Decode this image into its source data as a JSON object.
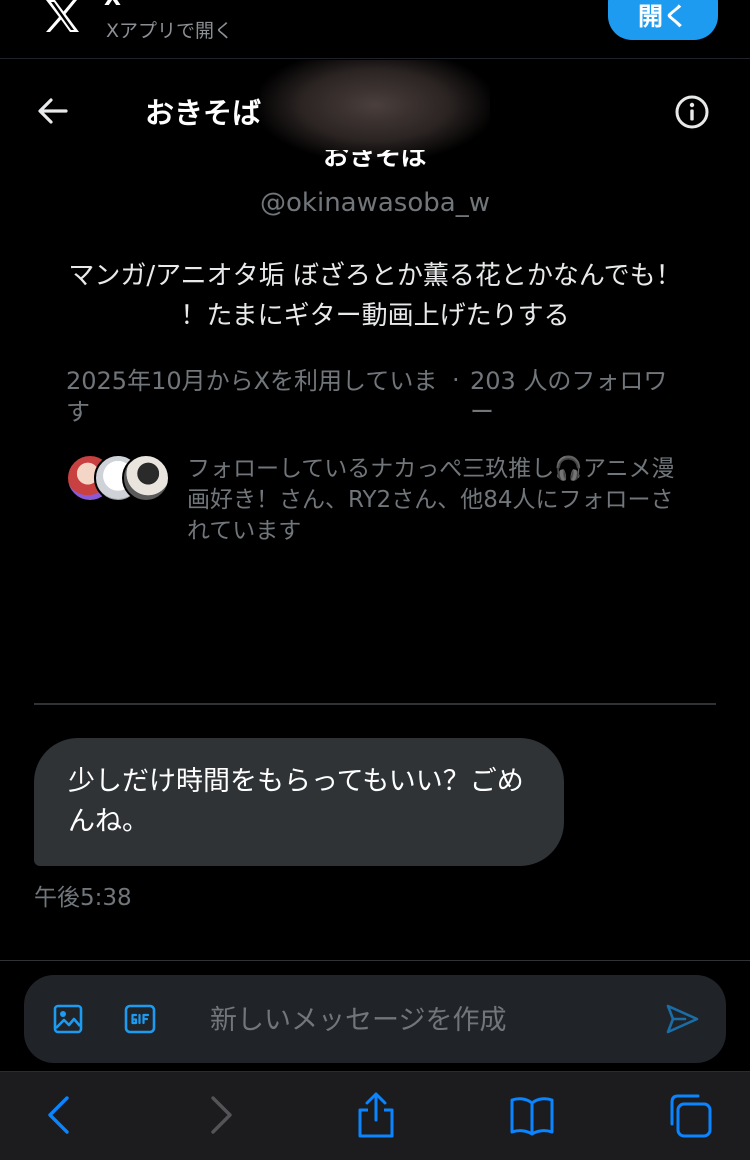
{
  "banner": {
    "logo": "x-logo-icon",
    "title": "X",
    "subtitle": "Xアプリで開く",
    "open_label": "開く"
  },
  "header": {
    "back_icon": "arrow-left-icon",
    "title": "おきそば",
    "info_icon": "info-circle-icon"
  },
  "profile": {
    "name": "おきそば",
    "handle": "@okinawasoba_w",
    "bio": "マンガ/アニオタ垢 ぼざろとか薫る花とかなんでも！ ！たまにギター動画上げたりする",
    "joined": "2025年10月からXを利用しています",
    "separator": "·",
    "followers": "203 人のフォロワー",
    "followed_by": "フォローしているナカっぺ三玖推し🎧アニメ漫画好き！さん、RY2さん、他84人にフォローされています"
  },
  "messages": [
    {
      "text": "少しだけ時間をもらってもいい？ごめんね。",
      "time": "午後5:38"
    }
  ],
  "composer": {
    "image_icon": "image-icon",
    "gif_icon": "gif-icon",
    "placeholder": "新しいメッセージを作成",
    "send_icon": "send-icon"
  },
  "toolbar": {
    "icons": [
      "chevron-left-icon",
      "chevron-right-icon",
      "share-icon",
      "bookmarks-icon",
      "tabs-icon"
    ]
  },
  "colors": {
    "background": "#000000",
    "accent": "#1d9bf0",
    "bubble": "#2f3336",
    "muted_text": "#71767b",
    "toolbar": "#1c1c1e"
  }
}
